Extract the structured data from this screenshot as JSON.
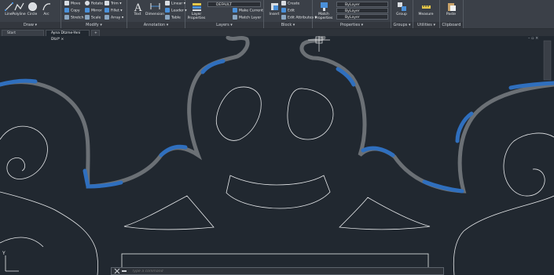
{
  "ribbon": {
    "draw": {
      "title": "Draw ▾",
      "line": "Line",
      "polyline": "Polyline",
      "circle": "Circle",
      "arc": "Arc"
    },
    "modify": {
      "title": "Modify ▾",
      "move": "Move",
      "copy": "Copy",
      "stretch": "Stretch",
      "rotate": "Rotate",
      "mirror": "Mirror",
      "scale": "Scale",
      "trim": "Trim ▾",
      "fillet": "Fillet ▾",
      "array": "Array ▾"
    },
    "annotation": {
      "title": "Annotation ▾",
      "text": "Text",
      "dimension": "Dimension",
      "linear": "Linear ▾",
      "leader": "Leader ▾",
      "table": "Table"
    },
    "layers": {
      "title": "Layers ▾",
      "layer_properties": "Layer Properties",
      "current_layer": "DEFAULT",
      "make_current": "Make Current",
      "match_layer": "Match Layer"
    },
    "block": {
      "title": "Block ▾",
      "insert": "Insert",
      "create": "Create",
      "edit": "Edit",
      "edit_attributes": "Edit Attributes ▾"
    },
    "properties": {
      "title": "Properties ▾",
      "match_properties": "Match Properties",
      "color": "ByLayer",
      "linetype": "ByLayer",
      "lineweight": "ByLayer"
    },
    "groups": {
      "title": "Groups ▾",
      "group": "Group"
    },
    "utilities": {
      "title": "Utilities ▾",
      "measure": "Measure"
    },
    "clipboard": {
      "title": "Clipboard",
      "paste": "Paste"
    }
  },
  "tabs": [
    {
      "label": "Start"
    },
    {
      "label": "Ayna Dtzme-Yeni Dtzl* ×"
    }
  ],
  "add_tab": "+",
  "viewport": {
    "colors": {
      "background": "#212830",
      "thick": "#6b7075",
      "accent": "#2f6fbe",
      "thin": "#e8eaec"
    },
    "axis_y": "Y",
    "window_controls": "– ▫ ×"
  },
  "command_line": {
    "placeholder": "Type a command"
  }
}
